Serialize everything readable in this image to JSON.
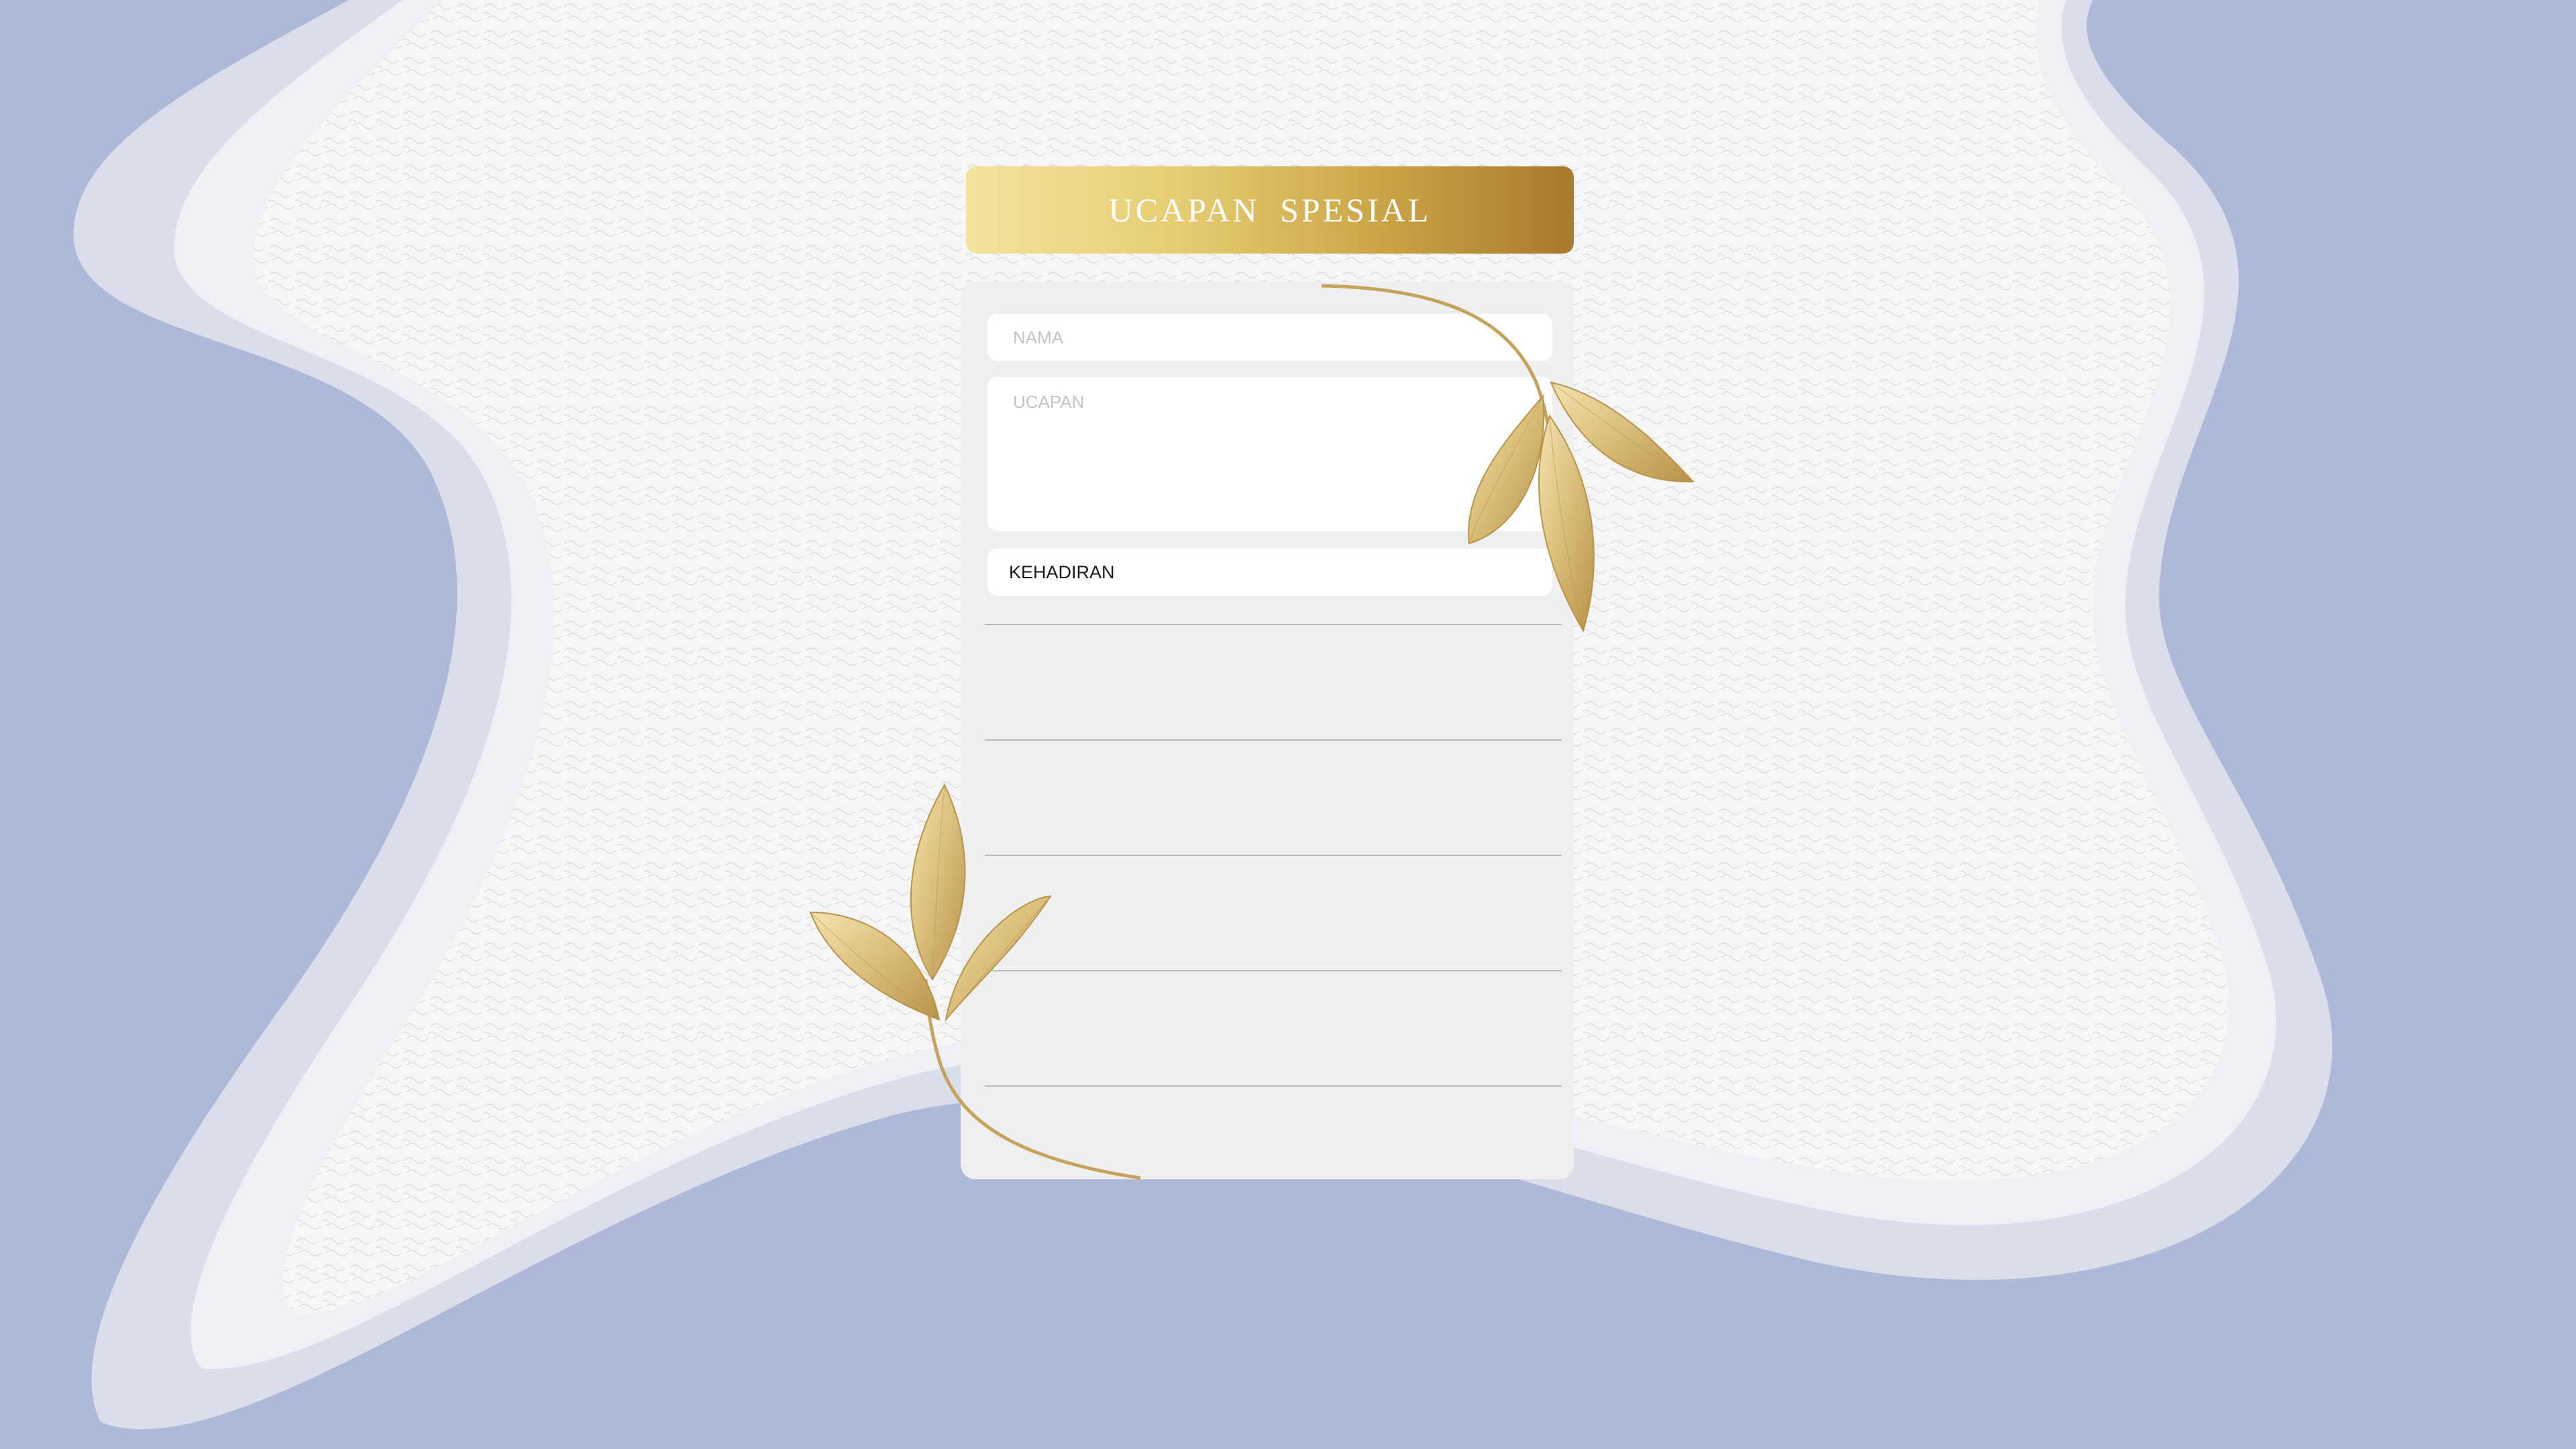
{
  "header": {
    "title": "UCAPAN SPESIAL"
  },
  "form": {
    "name_placeholder": "NAMA",
    "wish_placeholder": "UCAPAN",
    "attendance_label": "KEHADIRAN"
  },
  "entries": [
    {},
    {},
    {},
    {},
    {}
  ],
  "decorations": {
    "top_right": "gold-leaf-branch-icon",
    "bottom_left": "gold-leaf-branch-icon"
  },
  "colors": {
    "background_blue": "#adb9d6",
    "paper_white": "#f6f6f6",
    "gold_light": "#f2e49e",
    "gold_dark": "#a7792c",
    "panel_gray": "#efefef"
  }
}
